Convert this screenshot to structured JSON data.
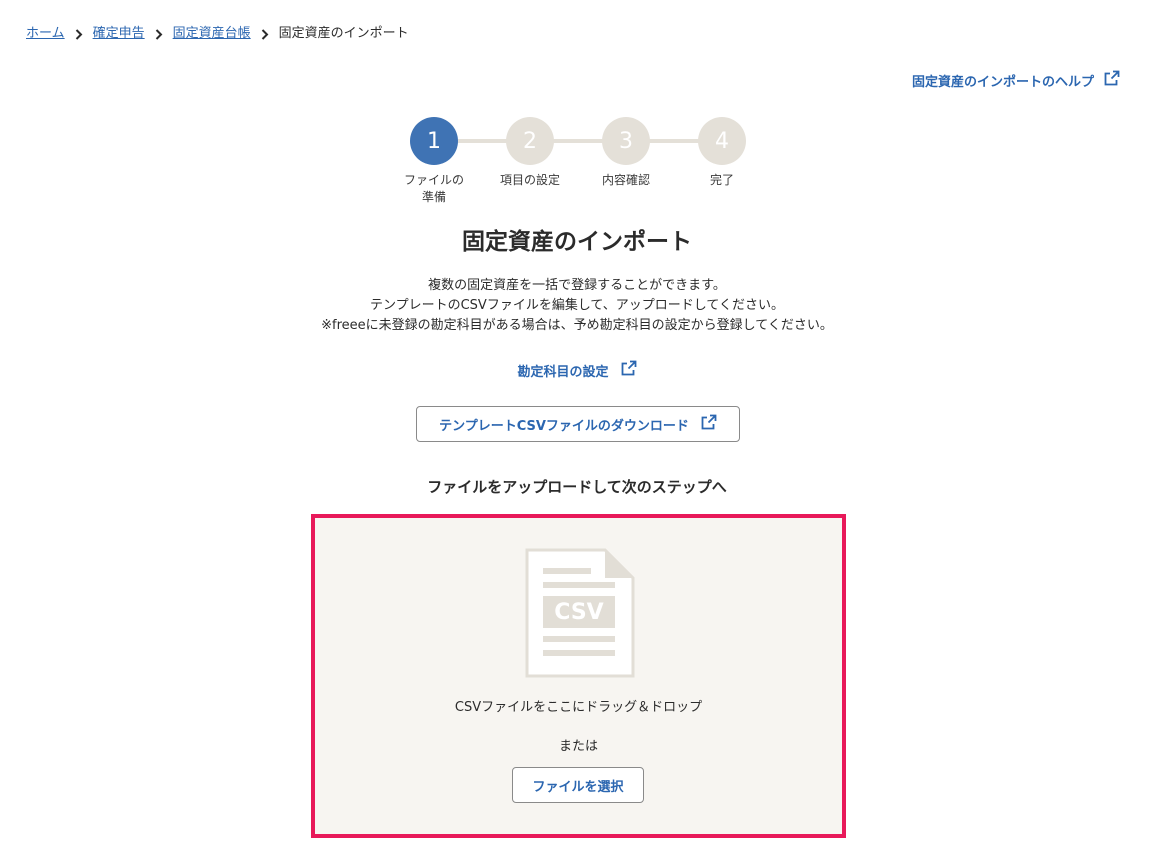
{
  "breadcrumb": {
    "items": [
      "ホーム",
      "確定申告",
      "固定資産台帳"
    ],
    "current": "固定資産のインポート"
  },
  "help_link": {
    "label": "固定資産のインポートのヘルプ"
  },
  "stepper": {
    "steps": [
      {
        "number": "1",
        "label": "ファイルの\n準備",
        "active": true
      },
      {
        "number": "2",
        "label": "項目の設定",
        "active": false
      },
      {
        "number": "3",
        "label": "内容確認",
        "active": false
      },
      {
        "number": "4",
        "label": "完了",
        "active": false
      }
    ]
  },
  "title": "固定資産のインポート",
  "description": [
    "複数の固定資産を一括で登録することができます。",
    "テンプレートのCSVファイルを編集して、アップロードしてください。",
    "※freeeに未登録の勘定科目がある場合は、予め勘定科目の設定から登録してください。"
  ],
  "account_settings_link": {
    "label": "勘定科目の設定"
  },
  "download_button": {
    "label": "テンプレートCSVファイルのダウンロード"
  },
  "upload_heading": "ファイルをアップロードして次のステップへ",
  "dropzone": {
    "icon_label": "CSV",
    "drop_text": "CSVファイルをここにドラッグ＆ドロップ",
    "or_text": "または",
    "select_button": "ファイルを選択"
  },
  "colors": {
    "link": "#2b66b0",
    "step_active": "#3f73b4",
    "step_inactive": "#e4e0d8",
    "dropzone_border": "#e8195a",
    "dropzone_bg": "#f7f5f1"
  }
}
